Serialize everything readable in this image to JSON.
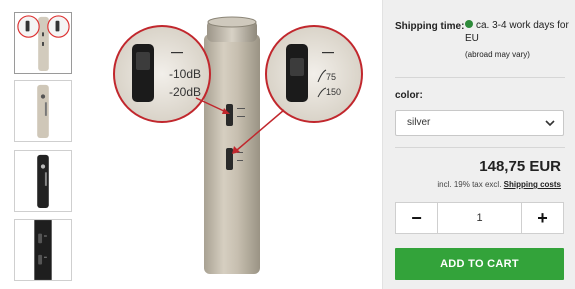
{
  "thumbnails": [
    {
      "name": "thumb-1",
      "icon": "closeup-mic-switch",
      "active": true
    },
    {
      "name": "thumb-2",
      "icon": "silver-mic-body",
      "active": false
    },
    {
      "name": "thumb-3",
      "icon": "black-mic-body",
      "active": false
    },
    {
      "name": "thumb-4",
      "icon": "black-mic-closeup",
      "active": false
    }
  ],
  "main_image": {
    "left_callout": {
      "label_1": "-10dB",
      "label_2": "-20dB"
    },
    "right_callout": {
      "label_1": "75",
      "label_2": "150"
    }
  },
  "shipping": {
    "label": "Shipping time:",
    "value": "ca. 3-4 work days for EU",
    "note": "(abroad may vary)",
    "status_color": "#2e8b3a"
  },
  "color": {
    "label": "color:",
    "selected": "silver"
  },
  "price": {
    "amount": "148,75 EUR",
    "tax_note": "incl. 19% tax excl.",
    "shipping_link": "Shipping costs"
  },
  "quantity": {
    "minus": "−",
    "value": "1",
    "plus": "+"
  },
  "cart": {
    "label": "ADD TO CART",
    "color": "#33a33a"
  }
}
